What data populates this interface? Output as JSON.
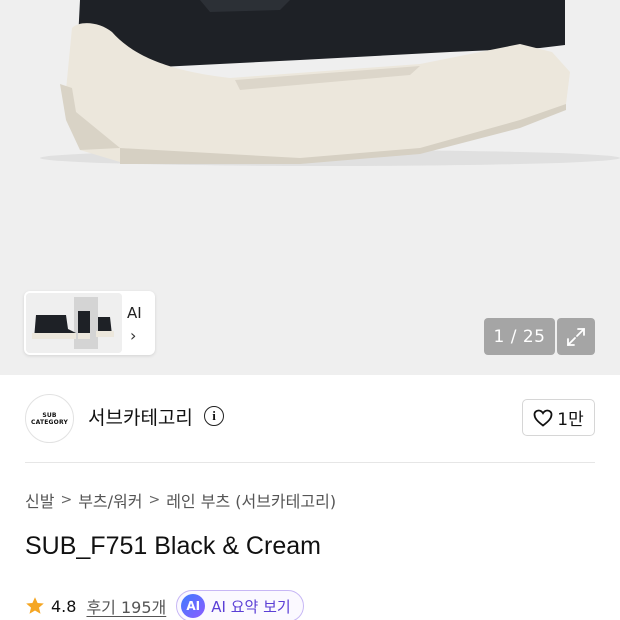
{
  "gallery": {
    "thumbnail_ai_label": "AI",
    "thumbnail_chevron": "›",
    "counter": "1 / 25",
    "expand_icon": "expand-icon"
  },
  "brand": {
    "logo_line1": "SUB",
    "logo_line2": "CATEGORY",
    "name": "서브카테고리",
    "info_icon": "i",
    "like_count": "1만"
  },
  "breadcrumb": {
    "items": [
      "신발",
      "부츠/워커",
      "레인 부츠 (서브카테고리)"
    ],
    "separator": ">"
  },
  "product": {
    "title": "SUB_F751 Black & Cream"
  },
  "rating": {
    "score": "4.8",
    "reviews": "후기 195개",
    "ai_badge": "AI",
    "ai_summary": "AI 요약 보기"
  },
  "colors": {
    "star": "#f5a623",
    "ai_purple": "#5b3fd6",
    "boot_black": "#1e2126",
    "boot_cream": "#ece7dc"
  }
}
